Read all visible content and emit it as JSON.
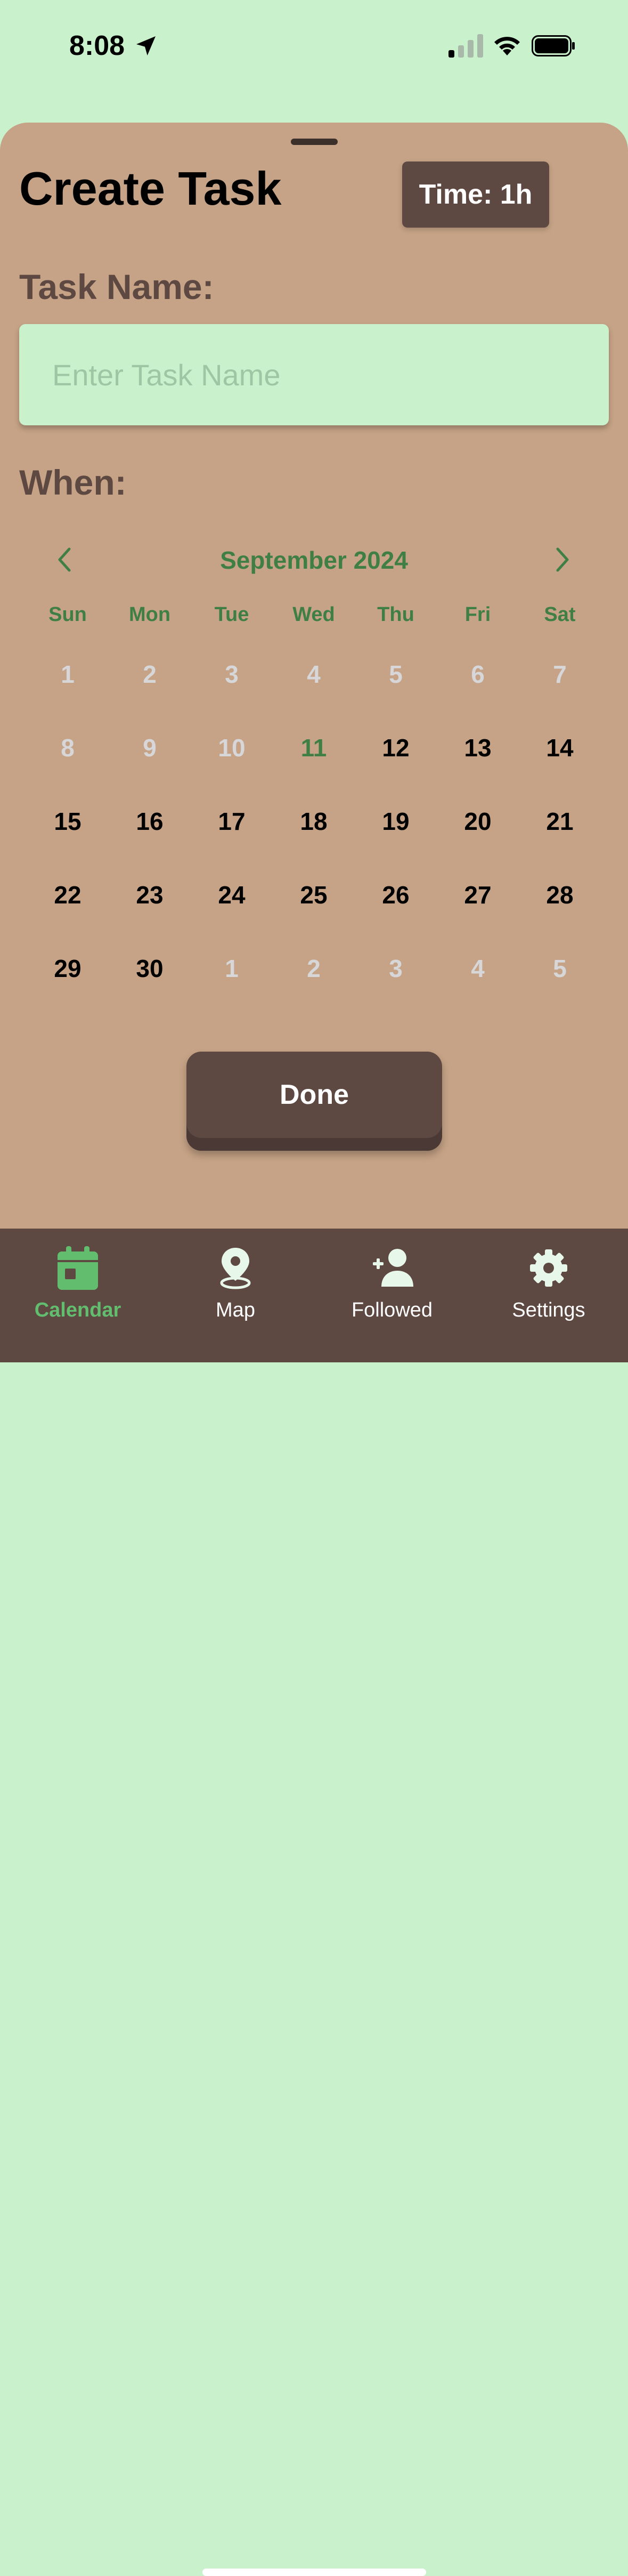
{
  "status_bar": {
    "time": "8:08"
  },
  "sheet": {
    "title": "Create Task",
    "time_badge": "Time: 1h",
    "task_name_label": "Task Name:",
    "task_name_placeholder": "Enter Task Name",
    "task_name_value": "",
    "when_label": "When:"
  },
  "calendar": {
    "month_label": "September 2024",
    "weekdays": [
      "Sun",
      "Mon",
      "Tue",
      "Wed",
      "Thu",
      "Fri",
      "Sat"
    ],
    "days": [
      {
        "label": "1",
        "state": "muted"
      },
      {
        "label": "2",
        "state": "muted"
      },
      {
        "label": "3",
        "state": "muted"
      },
      {
        "label": "4",
        "state": "muted"
      },
      {
        "label": "5",
        "state": "muted"
      },
      {
        "label": "6",
        "state": "muted"
      },
      {
        "label": "7",
        "state": "muted"
      },
      {
        "label": "8",
        "state": "muted"
      },
      {
        "label": "9",
        "state": "muted"
      },
      {
        "label": "10",
        "state": "muted"
      },
      {
        "label": "11",
        "state": "today"
      },
      {
        "label": "12",
        "state": "active"
      },
      {
        "label": "13",
        "state": "active"
      },
      {
        "label": "14",
        "state": "active"
      },
      {
        "label": "15",
        "state": "active"
      },
      {
        "label": "16",
        "state": "active"
      },
      {
        "label": "17",
        "state": "active"
      },
      {
        "label": "18",
        "state": "active"
      },
      {
        "label": "19",
        "state": "active"
      },
      {
        "label": "20",
        "state": "active"
      },
      {
        "label": "21",
        "state": "active"
      },
      {
        "label": "22",
        "state": "active"
      },
      {
        "label": "23",
        "state": "active"
      },
      {
        "label": "24",
        "state": "active"
      },
      {
        "label": "25",
        "state": "active"
      },
      {
        "label": "26",
        "state": "active"
      },
      {
        "label": "27",
        "state": "active"
      },
      {
        "label": "28",
        "state": "active"
      },
      {
        "label": "29",
        "state": "active"
      },
      {
        "label": "30",
        "state": "active"
      },
      {
        "label": "1",
        "state": "muted"
      },
      {
        "label": "2",
        "state": "muted"
      },
      {
        "label": "3",
        "state": "muted"
      },
      {
        "label": "4",
        "state": "muted"
      },
      {
        "label": "5",
        "state": "muted"
      }
    ]
  },
  "done_button": "Done",
  "tab_bar": {
    "calendar": "Calendar",
    "map": "Map",
    "followed": "Followed",
    "settings": "Settings"
  },
  "icons": {
    "status": [
      "location-arrow-icon",
      "cellular-signal-icon",
      "wifi-icon",
      "battery-icon"
    ],
    "calendar_nav": [
      "chevron-left-icon",
      "chevron-right-icon"
    ],
    "tabs": [
      "calendar-icon",
      "map-pin-icon",
      "add-person-icon",
      "gear-icon"
    ]
  },
  "colors": {
    "background_mint": "#c9f2cc",
    "sheet_tan": "#c6a386",
    "dark_brown": "#5d4842",
    "accent_green": "#3f7f46",
    "tab_active_green": "#63bd6e",
    "muted_day": "#d7d7d9"
  }
}
